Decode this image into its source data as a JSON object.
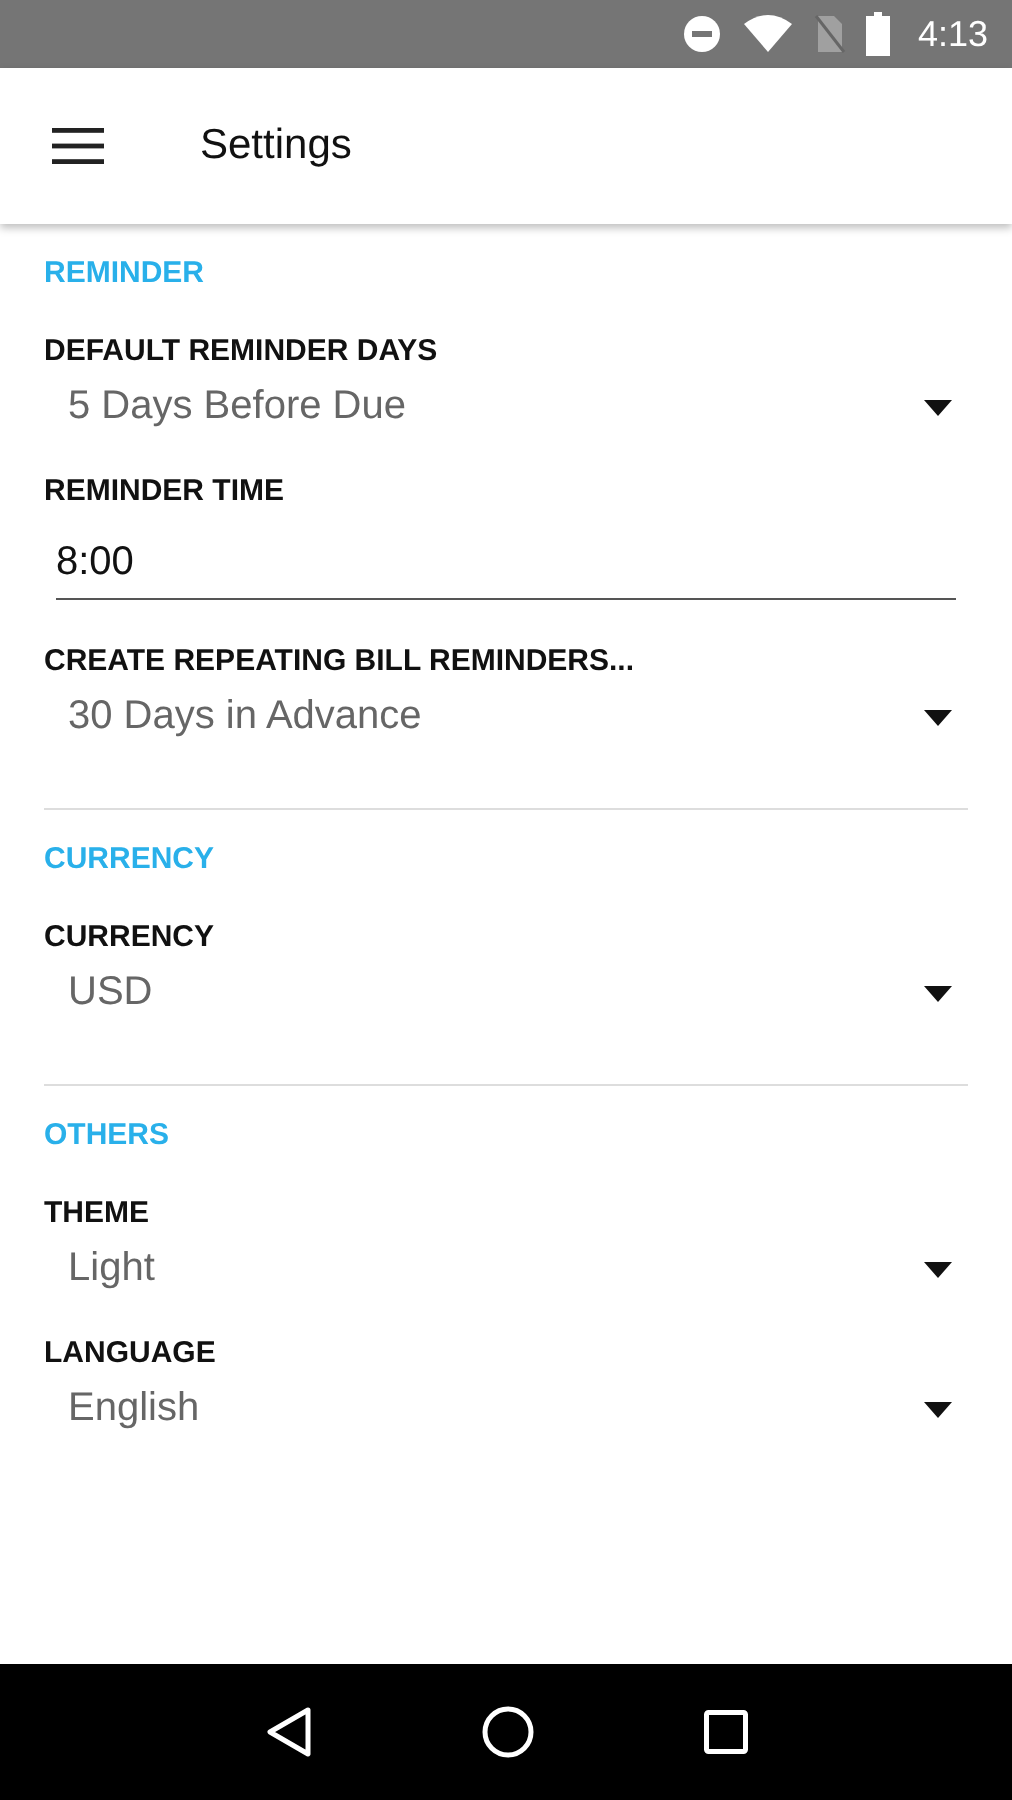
{
  "status_bar": {
    "time": "4:13"
  },
  "app_bar": {
    "title": "Settings"
  },
  "sections": [
    {
      "title": "REMINDER",
      "items": [
        {
          "kind": "dropdown",
          "label": "DEFAULT REMINDER DAYS",
          "value": "5 Days Before Due"
        },
        {
          "kind": "text",
          "label": "REMINDER TIME",
          "value": "8:00"
        },
        {
          "kind": "dropdown",
          "label": "CREATE REPEATING BILL REMINDERS...",
          "value": "30 Days in Advance"
        }
      ]
    },
    {
      "title": "CURRENCY",
      "items": [
        {
          "kind": "dropdown",
          "label": "CURRENCY",
          "value": "USD"
        }
      ]
    },
    {
      "title": "OTHERS",
      "items": [
        {
          "kind": "dropdown",
          "label": "THEME",
          "value": "Light"
        },
        {
          "kind": "dropdown",
          "label": "LANGUAGE",
          "value": "English"
        }
      ]
    }
  ]
}
